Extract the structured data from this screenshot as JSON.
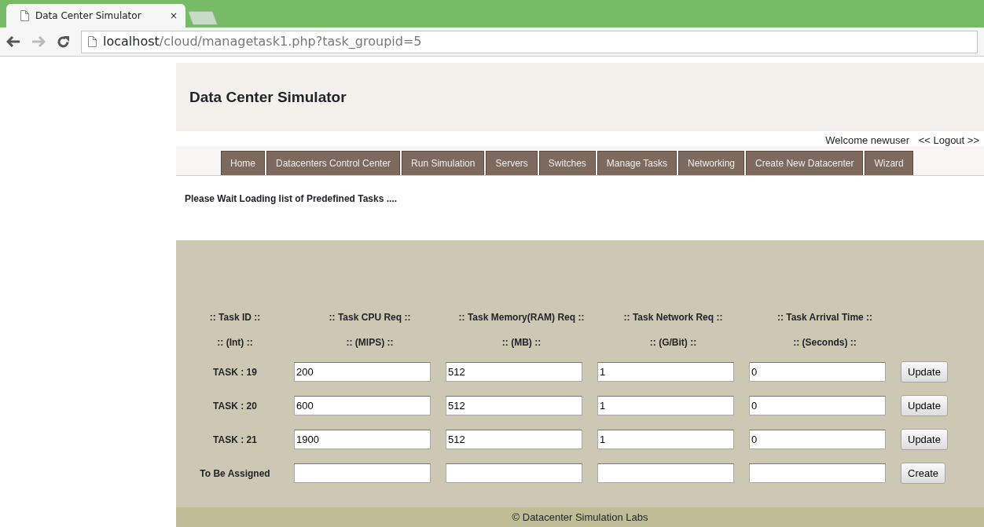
{
  "browser": {
    "tab_title": "Data Center Simulator",
    "tab_close": "×",
    "url_host": "localhost",
    "url_path": "/cloud/managetask1.php?task_groupid=5"
  },
  "header": {
    "title": "Data Center Simulator"
  },
  "user_bar": {
    "welcome": "Welcome newuser",
    "logout": "<< Logout >>"
  },
  "nav": [
    {
      "label": "Home"
    },
    {
      "label": "Datacenters Control Center"
    },
    {
      "label": "Run Simulation"
    },
    {
      "label": "Servers"
    },
    {
      "label": "Switches"
    },
    {
      "label": "Manage Tasks"
    },
    {
      "label": "Networking"
    },
    {
      "label": "Create New Datacenter"
    },
    {
      "label": "Wizard"
    }
  ],
  "status_message": "Please Wait Loading list of Predefined Tasks ....",
  "table": {
    "columns": [
      {
        "title": ":: Task ID ::",
        "unit": ":: (Int) ::"
      },
      {
        "title": ":: Task CPU Req ::",
        "unit": ":: (MIPS) ::"
      },
      {
        "title": ":: Task Memory(RAM) Req ::",
        "unit": ":: (MB) ::"
      },
      {
        "title": ":: Task Network Req ::",
        "unit": ":: (G/Bit) ::"
      },
      {
        "title": ":: Task Arrival Time ::",
        "unit": ":: (Seconds) ::"
      }
    ],
    "rows": [
      {
        "label": "TASK : 19",
        "values": [
          "200",
          "512",
          "1",
          "0"
        ],
        "button": "Update"
      },
      {
        "label": "TASK : 20",
        "values": [
          "600",
          "512",
          "1",
          "0"
        ],
        "button": "Update"
      },
      {
        "label": "TASK : 21",
        "values": [
          "1900",
          "512",
          "1",
          "0"
        ],
        "button": "Update"
      },
      {
        "label": "To Be Assigned",
        "values": [],
        "button": "Create"
      }
    ]
  },
  "footer": "© Datacenter Simulation Labs"
}
